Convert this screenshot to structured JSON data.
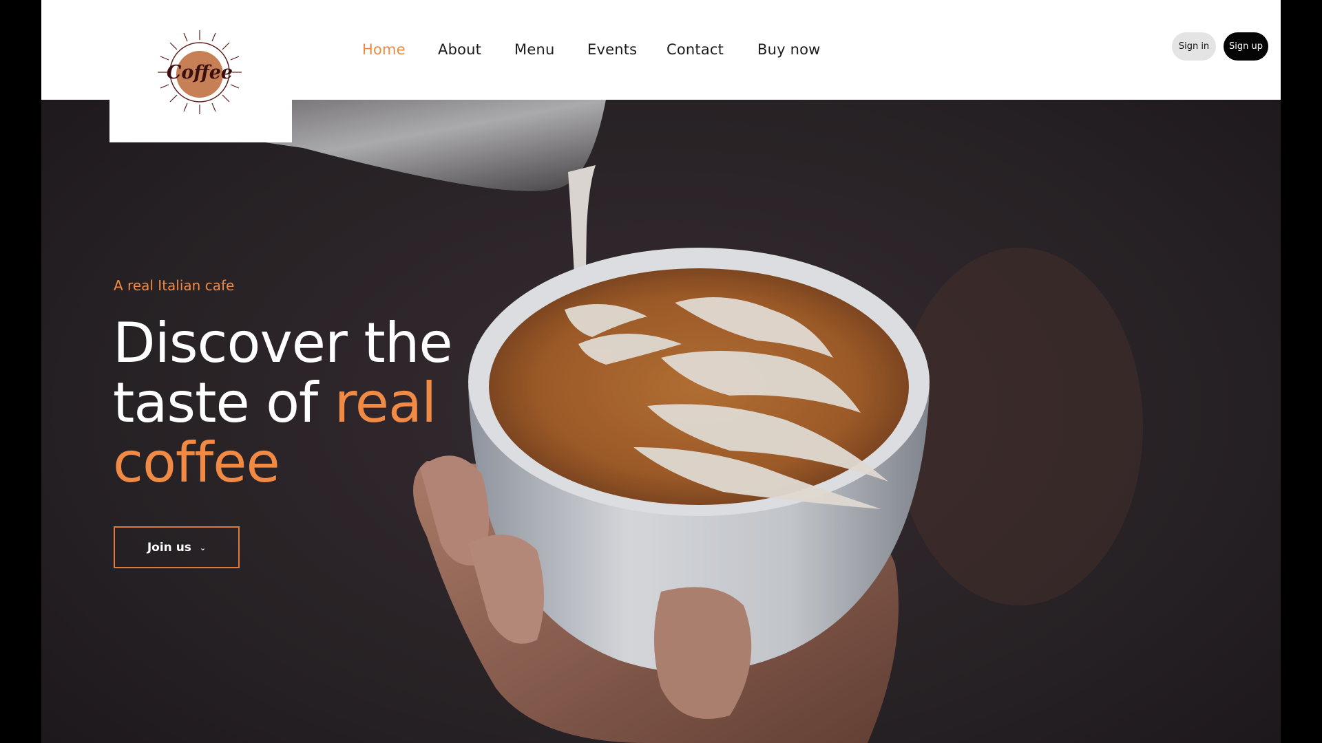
{
  "brand": {
    "logo_text": "Coffee"
  },
  "nav": {
    "items": [
      {
        "label": "Home",
        "active": true
      },
      {
        "label": "About",
        "active": false
      },
      {
        "label": "Menu",
        "active": false
      },
      {
        "label": "Events",
        "active": false
      },
      {
        "label": "Contact",
        "active": false
      },
      {
        "label": "Buy now",
        "active": false
      }
    ]
  },
  "auth": {
    "signin_label": "Sign in",
    "signup_label": "Sign up"
  },
  "hero": {
    "tagline": "A real Italian cafe",
    "headline_line1": "Discover the",
    "headline_line2_prefix": "taste of ",
    "headline_line2_accent": "real",
    "headline_line3_accent": "coffee",
    "cta_label": "Join us",
    "cta_icon": "chevron-down-icon"
  },
  "colors": {
    "accent": "#f08a45",
    "header_bg": "#ffffff",
    "hero_bg": "#2a2428",
    "signin_bg": "#e4e4e4",
    "signup_bg": "#050505"
  }
}
